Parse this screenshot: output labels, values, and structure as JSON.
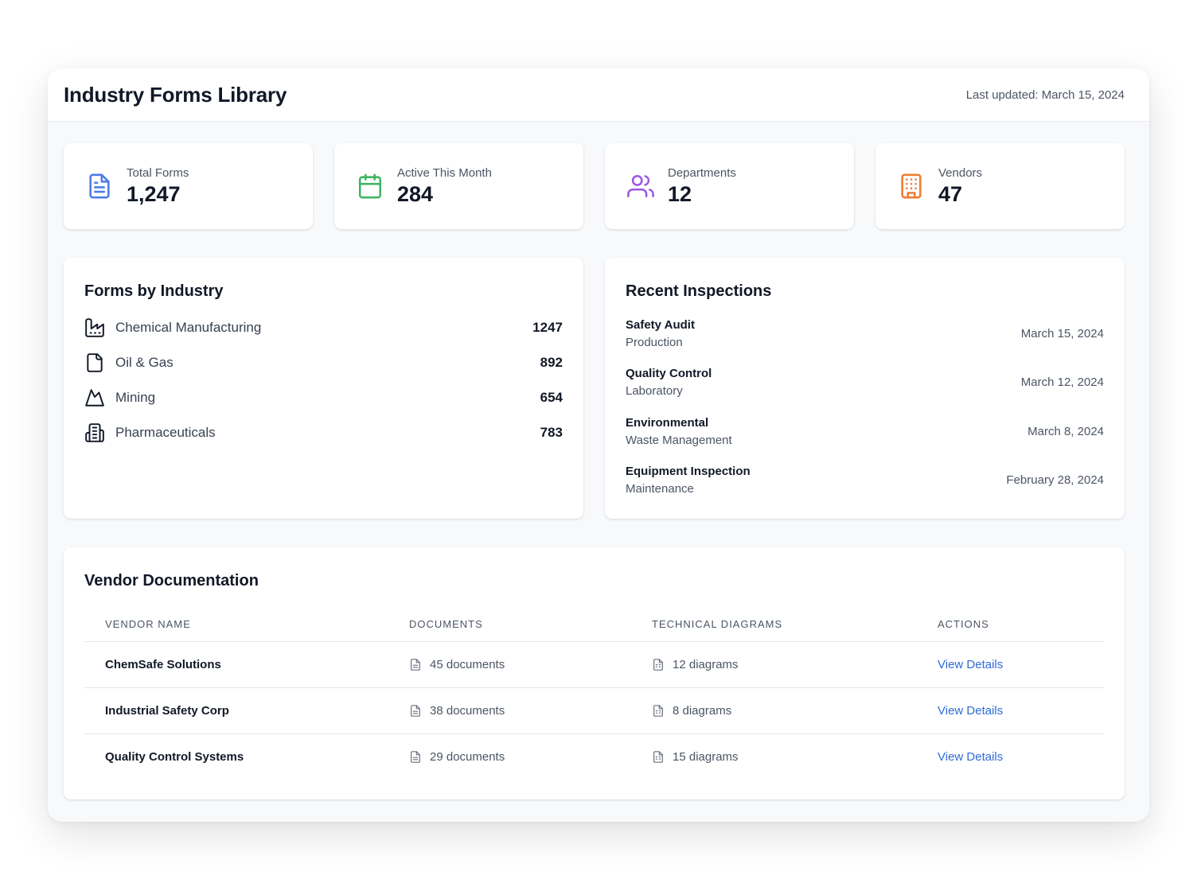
{
  "header": {
    "title": "Industry Forms Library",
    "last_updated": "Last updated: March 15, 2024"
  },
  "stats": [
    {
      "label": "Total Forms",
      "value": "1,247",
      "icon": "document-icon",
      "color": "#4f7be8"
    },
    {
      "label": "Active This Month",
      "value": "284",
      "icon": "calendar-icon",
      "color": "#3fb563"
    },
    {
      "label": "Departments",
      "value": "12",
      "icon": "users-icon",
      "color": "#9b59e3"
    },
    {
      "label": "Vendors",
      "value": "47",
      "icon": "building-icon",
      "color": "#ee7c35"
    }
  ],
  "industries": {
    "title": "Forms by Industry",
    "items": [
      {
        "name": "Chemical Manufacturing",
        "count": "1247",
        "icon": "factory-icon"
      },
      {
        "name": "Oil & Gas",
        "count": "892",
        "icon": "file-icon"
      },
      {
        "name": "Mining",
        "count": "654",
        "icon": "mountain-icon"
      },
      {
        "name": "Pharmaceuticals",
        "count": "783",
        "icon": "pharma-building-icon"
      }
    ]
  },
  "inspections": {
    "title": "Recent Inspections",
    "items": [
      {
        "title": "Safety Audit",
        "department": "Production",
        "date": "March 15, 2024"
      },
      {
        "title": "Quality Control",
        "department": "Laboratory",
        "date": "March 12, 2024"
      },
      {
        "title": "Environmental",
        "department": "Waste Management",
        "date": "March 8, 2024"
      },
      {
        "title": "Equipment Inspection",
        "department": "Maintenance",
        "date": "February 28, 2024"
      }
    ]
  },
  "vendors": {
    "title": "Vendor Documentation",
    "columns": [
      "VENDOR NAME",
      "DOCUMENTS",
      "TECHNICAL DIAGRAMS",
      "ACTIONS"
    ],
    "rows": [
      {
        "name": "ChemSafe Solutions",
        "documents": "45 documents",
        "diagrams": "12 diagrams",
        "action": "View Details"
      },
      {
        "name": "Industrial Safety Corp",
        "documents": "38 documents",
        "diagrams": "8 diagrams",
        "action": "View Details"
      },
      {
        "name": "Quality Control Systems",
        "documents": "29 documents",
        "diagrams": "15 diagrams",
        "action": "View Details"
      }
    ]
  },
  "colors": {
    "link": "#2f6bd9",
    "text_primary": "#111827",
    "text_secondary": "#4b5563"
  }
}
